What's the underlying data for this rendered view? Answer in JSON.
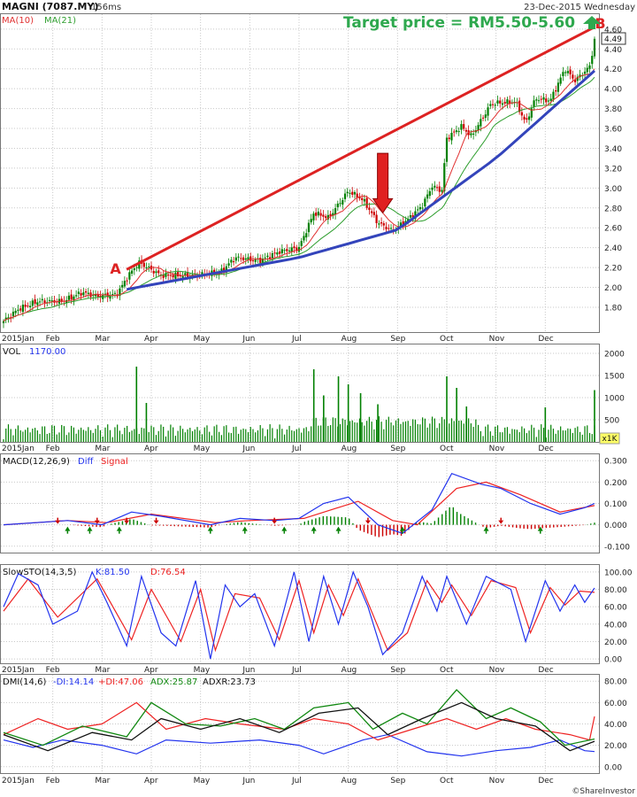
{
  "header": {
    "symbol": "MAGNI (7087.MY)",
    "render_time": "156ms",
    "date": "23-Dec-2015 Wednesday",
    "ma_fast_label": "MA(10)",
    "ma_slow_label": "MA(21)",
    "last_price": "4.49",
    "vol_scale": "x1K",
    "credit": "©ShareInvestor"
  },
  "annotations": {
    "target": "Target price =  RM5.50-5.60",
    "point_a": "A",
    "point_b": "B"
  },
  "colors": {
    "up": "#008000",
    "down": "#cc0000",
    "ma_fast": "#e03030",
    "ma_slow": "#2e9e2e",
    "resistance": "#dd2222",
    "support": "#3344bb",
    "target_text": "#2ea84e",
    "grid": "#c8c8c8",
    "macd_diff": "#2233ee",
    "macd_signal": "#ee2222",
    "sto_k": "#2233ee",
    "sto_d": "#ee2222",
    "dmi_minus": "#2233ee",
    "dmi_plus": "#ee2222",
    "adx": "#118811",
    "adxr": "#111111"
  },
  "chart_data": [
    {
      "type": "candlestick",
      "title": "MAGNI (7087.MY)",
      "x_ticks": [
        "2015Jan",
        "Feb",
        "Mar",
        "Apr",
        "May",
        "Jun",
        "Jul",
        "Aug",
        "Sep",
        "Oct",
        "Nov",
        "Dec"
      ],
      "y_ticks": [
        "1.80",
        "2.00",
        "2.20",
        "2.40",
        "2.60",
        "2.80",
        "3.00",
        "3.20",
        "3.40",
        "3.60",
        "3.80",
        "4.00",
        "4.20",
        "4.40",
        "4.60"
      ],
      "ylim": [
        1.55,
        4.75
      ],
      "close_anchors": [
        {
          "month": 0.0,
          "value": 1.66
        },
        {
          "month": 0.3,
          "value": 1.78
        },
        {
          "month": 0.7,
          "value": 1.86
        },
        {
          "month": 1.2,
          "value": 1.86
        },
        {
          "month": 1.6,
          "value": 1.95
        },
        {
          "month": 1.9,
          "value": 1.91
        },
        {
          "month": 2.3,
          "value": 1.93
        },
        {
          "month": 2.55,
          "value": 2.13
        },
        {
          "month": 2.75,
          "value": 2.25
        },
        {
          "month": 3.2,
          "value": 2.12
        },
        {
          "month": 3.8,
          "value": 2.12
        },
        {
          "month": 4.4,
          "value": 2.15
        },
        {
          "month": 4.7,
          "value": 2.3
        },
        {
          "month": 5.2,
          "value": 2.27
        },
        {
          "month": 5.6,
          "value": 2.36
        },
        {
          "month": 6.0,
          "value": 2.4
        },
        {
          "month": 6.3,
          "value": 2.75
        },
        {
          "month": 6.6,
          "value": 2.7
        },
        {
          "month": 7.0,
          "value": 2.97
        },
        {
          "month": 7.3,
          "value": 2.88
        },
        {
          "month": 7.6,
          "value": 2.65
        },
        {
          "month": 7.9,
          "value": 2.57
        },
        {
          "month": 8.2,
          "value": 2.68
        },
        {
          "month": 8.5,
          "value": 2.82
        },
        {
          "month": 8.7,
          "value": 3.02
        },
        {
          "month": 8.9,
          "value": 2.97
        },
        {
          "month": 9.0,
          "value": 3.5
        },
        {
          "month": 9.3,
          "value": 3.62
        },
        {
          "month": 9.5,
          "value": 3.52
        },
        {
          "month": 9.9,
          "value": 3.85
        },
        {
          "month": 10.4,
          "value": 3.87
        },
        {
          "month": 10.6,
          "value": 3.65
        },
        {
          "month": 10.8,
          "value": 3.9
        },
        {
          "month": 11.1,
          "value": 3.88
        },
        {
          "month": 11.4,
          "value": 4.2
        },
        {
          "month": 11.6,
          "value": 4.08
        },
        {
          "month": 11.9,
          "value": 4.22
        },
        {
          "month": 12.0,
          "value": 4.49
        }
      ],
      "resistance_line": [
        {
          "month": 2.5,
          "value": 2.18
        },
        {
          "month": 12.0,
          "value": 4.62
        }
      ],
      "support_points": [
        {
          "month": 2.5,
          "value": 1.98
        },
        {
          "month": 6.0,
          "value": 2.3
        },
        {
          "month": 8.0,
          "value": 2.58
        },
        {
          "month": 10.0,
          "value": 3.3
        },
        {
          "month": 12.0,
          "value": 4.18
        }
      ],
      "arrow": {
        "month": 7.7,
        "value_top": 3.35,
        "value_tip": 2.75
      },
      "point_a": {
        "month": 2.45,
        "value": 2.19
      },
      "point_b": {
        "month": 11.9,
        "value": 4.66
      }
    },
    {
      "type": "bar",
      "name": "VOL",
      "value_label": "1170.00",
      "y_ticks": [
        "500",
        "1000",
        "1500",
        "2000"
      ],
      "ylim": [
        0,
        2200
      ],
      "spikes": [
        {
          "month": 2.7,
          "value": 1700
        },
        {
          "month": 2.9,
          "value": 880
        },
        {
          "month": 6.3,
          "value": 1640
        },
        {
          "month": 6.5,
          "value": 1050
        },
        {
          "month": 6.8,
          "value": 1480
        },
        {
          "month": 7.0,
          "value": 1300
        },
        {
          "month": 7.25,
          "value": 1100
        },
        {
          "month": 7.6,
          "value": 850
        },
        {
          "month": 9.0,
          "value": 1480
        },
        {
          "month": 9.2,
          "value": 1220
        },
        {
          "month": 9.4,
          "value": 800
        },
        {
          "month": 11.0,
          "value": 780
        },
        {
          "month": 12.0,
          "value": 1170
        }
      ]
    },
    {
      "type": "line",
      "name": "MACD(12,26,9)",
      "series_labels": [
        "Diff",
        "Signal"
      ],
      "y_ticks": [
        "-0.100",
        "0.000",
        "0.100",
        "0.200",
        "0.300"
      ],
      "ylim": [
        -0.13,
        0.33
      ],
      "diff": [
        {
          "month": 0.0,
          "value": 0.0
        },
        {
          "month": 1.3,
          "value": 0.02
        },
        {
          "month": 2.0,
          "value": 0.0
        },
        {
          "month": 2.6,
          "value": 0.06
        },
        {
          "month": 3.2,
          "value": 0.04
        },
        {
          "month": 4.2,
          "value": 0.0
        },
        {
          "month": 4.8,
          "value": 0.03
        },
        {
          "month": 5.5,
          "value": 0.02
        },
        {
          "month": 6.0,
          "value": 0.03
        },
        {
          "month": 6.5,
          "value": 0.1
        },
        {
          "month": 7.0,
          "value": 0.13
        },
        {
          "month": 7.6,
          "value": 0.0
        },
        {
          "month": 8.1,
          "value": -0.04
        },
        {
          "month": 8.7,
          "value": 0.07
        },
        {
          "month": 9.1,
          "value": 0.24
        },
        {
          "month": 9.7,
          "value": 0.19
        },
        {
          "month": 10.1,
          "value": 0.17
        },
        {
          "month": 10.7,
          "value": 0.1
        },
        {
          "month": 11.3,
          "value": 0.05
        },
        {
          "month": 11.8,
          "value": 0.08
        },
        {
          "month": 12.0,
          "value": 0.1
        }
      ],
      "signal": [
        {
          "month": 0.0,
          "value": 0.0
        },
        {
          "month": 1.3,
          "value": 0.02
        },
        {
          "month": 2.1,
          "value": 0.01
        },
        {
          "month": 3.0,
          "value": 0.05
        },
        {
          "month": 4.3,
          "value": 0.01
        },
        {
          "month": 5.0,
          "value": 0.02
        },
        {
          "month": 6.1,
          "value": 0.03
        },
        {
          "month": 7.2,
          "value": 0.11
        },
        {
          "month": 7.9,
          "value": 0.02
        },
        {
          "month": 8.4,
          "value": 0.0
        },
        {
          "month": 9.2,
          "value": 0.17
        },
        {
          "month": 9.8,
          "value": 0.2
        },
        {
          "month": 10.5,
          "value": 0.14
        },
        {
          "month": 11.3,
          "value": 0.06
        },
        {
          "month": 12.0,
          "value": 0.09
        }
      ],
      "buy_signal_months": [
        1.3,
        1.75,
        2.35,
        4.2,
        4.9,
        5.7,
        6.3,
        6.8,
        8.1,
        9.8,
        10.9
      ],
      "sell_signal_months": [
        1.1,
        1.9,
        2.5,
        3.1,
        5.5,
        7.4,
        10.1
      ]
    },
    {
      "type": "line",
      "name": "SlowSTO(14,3,5)",
      "series_labels": [
        "K:81.50",
        "D:76.54"
      ],
      "y_ticks": [
        "0.00",
        "20.00",
        "40.00",
        "60.00",
        "80.00",
        "100.00"
      ],
      "ylim": [
        -5,
        108
      ],
      "k": [
        {
          "month": 0.0,
          "value": 60
        },
        {
          "month": 0.3,
          "value": 98
        },
        {
          "month": 0.7,
          "value": 85
        },
        {
          "month": 1.0,
          "value": 40
        },
        {
          "month": 1.5,
          "value": 55
        },
        {
          "month": 1.8,
          "value": 100
        },
        {
          "month": 2.1,
          "value": 65
        },
        {
          "month": 2.5,
          "value": 15
        },
        {
          "month": 2.8,
          "value": 95
        },
        {
          "month": 3.2,
          "value": 30
        },
        {
          "month": 3.5,
          "value": 15
        },
        {
          "month": 3.9,
          "value": 90
        },
        {
          "month": 4.2,
          "value": 0
        },
        {
          "month": 4.5,
          "value": 85
        },
        {
          "month": 4.8,
          "value": 60
        },
        {
          "month": 5.1,
          "value": 75
        },
        {
          "month": 5.5,
          "value": 15
        },
        {
          "month": 5.9,
          "value": 100
        },
        {
          "month": 6.2,
          "value": 20
        },
        {
          "month": 6.5,
          "value": 95
        },
        {
          "month": 6.8,
          "value": 40
        },
        {
          "month": 7.1,
          "value": 100
        },
        {
          "month": 7.4,
          "value": 60
        },
        {
          "month": 7.7,
          "value": 5
        },
        {
          "month": 8.1,
          "value": 30
        },
        {
          "month": 8.5,
          "value": 95
        },
        {
          "month": 8.8,
          "value": 55
        },
        {
          "month": 9.0,
          "value": 95
        },
        {
          "month": 9.4,
          "value": 40
        },
        {
          "month": 9.8,
          "value": 95
        },
        {
          "month": 10.3,
          "value": 80
        },
        {
          "month": 10.6,
          "value": 20
        },
        {
          "month": 11.0,
          "value": 90
        },
        {
          "month": 11.3,
          "value": 55
        },
        {
          "month": 11.6,
          "value": 85
        },
        {
          "month": 11.8,
          "value": 65
        },
        {
          "month": 12.0,
          "value": 81.5
        }
      ],
      "d": [
        {
          "month": 0.0,
          "value": 55
        },
        {
          "month": 0.5,
          "value": 92
        },
        {
          "month": 1.1,
          "value": 48
        },
        {
          "month": 1.9,
          "value": 92
        },
        {
          "month": 2.6,
          "value": 22
        },
        {
          "month": 3.0,
          "value": 80
        },
        {
          "month": 3.6,
          "value": 20
        },
        {
          "month": 4.0,
          "value": 80
        },
        {
          "month": 4.3,
          "value": 10
        },
        {
          "month": 4.7,
          "value": 75
        },
        {
          "month": 5.2,
          "value": 70
        },
        {
          "month": 5.6,
          "value": 22
        },
        {
          "month": 6.0,
          "value": 90
        },
        {
          "month": 6.3,
          "value": 30
        },
        {
          "month": 6.6,
          "value": 85
        },
        {
          "month": 6.9,
          "value": 50
        },
        {
          "month": 7.2,
          "value": 92
        },
        {
          "month": 7.8,
          "value": 10
        },
        {
          "month": 8.2,
          "value": 30
        },
        {
          "month": 8.6,
          "value": 90
        },
        {
          "month": 8.9,
          "value": 65
        },
        {
          "month": 9.1,
          "value": 85
        },
        {
          "month": 9.5,
          "value": 50
        },
        {
          "month": 9.9,
          "value": 90
        },
        {
          "month": 10.4,
          "value": 82
        },
        {
          "month": 10.7,
          "value": 30
        },
        {
          "month": 11.1,
          "value": 82
        },
        {
          "month": 11.4,
          "value": 62
        },
        {
          "month": 11.7,
          "value": 78
        },
        {
          "month": 12.0,
          "value": 76.5
        }
      ]
    },
    {
      "type": "line",
      "name": "DMI(14,6)",
      "series_labels": [
        "-DI:14.14",
        "+DI:47.06",
        "ADX:25.87",
        "ADXR:23.73"
      ],
      "y_ticks": [
        "0.00",
        "20.00",
        "40.00",
        "60.00",
        "80.00"
      ],
      "ylim": [
        -6,
        86
      ],
      "minus_di": [
        {
          "month": 0.0,
          "value": 25
        },
        {
          "month": 0.6,
          "value": 18
        },
        {
          "month": 1.2,
          "value": 25
        },
        {
          "month": 2.0,
          "value": 20
        },
        {
          "month": 2.7,
          "value": 12
        },
        {
          "month": 3.3,
          "value": 25
        },
        {
          "month": 4.2,
          "value": 22
        },
        {
          "month": 5.2,
          "value": 25
        },
        {
          "month": 6.0,
          "value": 20
        },
        {
          "month": 6.5,
          "value": 12
        },
        {
          "month": 7.3,
          "value": 25
        },
        {
          "month": 7.8,
          "value": 30
        },
        {
          "month": 8.6,
          "value": 14
        },
        {
          "month": 9.3,
          "value": 10
        },
        {
          "month": 10.0,
          "value": 15
        },
        {
          "month": 10.7,
          "value": 18
        },
        {
          "month": 11.3,
          "value": 25
        },
        {
          "month": 11.8,
          "value": 15
        },
        {
          "month": 12.0,
          "value": 14.14
        }
      ],
      "plus_di": [
        {
          "month": 0.0,
          "value": 30
        },
        {
          "month": 0.7,
          "value": 45
        },
        {
          "month": 1.3,
          "value": 35
        },
        {
          "month": 2.0,
          "value": 40
        },
        {
          "month": 2.7,
          "value": 60
        },
        {
          "month": 3.3,
          "value": 35
        },
        {
          "month": 4.1,
          "value": 45
        },
        {
          "month": 4.8,
          "value": 40
        },
        {
          "month": 5.7,
          "value": 35
        },
        {
          "month": 6.3,
          "value": 45
        },
        {
          "month": 7.0,
          "value": 40
        },
        {
          "month": 7.6,
          "value": 25
        },
        {
          "month": 8.3,
          "value": 35
        },
        {
          "month": 9.0,
          "value": 45
        },
        {
          "month": 9.6,
          "value": 35
        },
        {
          "month": 10.2,
          "value": 45
        },
        {
          "month": 10.8,
          "value": 35
        },
        {
          "month": 11.5,
          "value": 30
        },
        {
          "month": 11.9,
          "value": 25
        },
        {
          "month": 12.0,
          "value": 47.06
        }
      ],
      "adx": [
        {
          "month": 0.0,
          "value": 32
        },
        {
          "month": 0.8,
          "value": 20
        },
        {
          "month": 1.6,
          "value": 38
        },
        {
          "month": 2.5,
          "value": 28
        },
        {
          "month": 3.0,
          "value": 60
        },
        {
          "month": 3.7,
          "value": 40
        },
        {
          "month": 4.4,
          "value": 38
        },
        {
          "month": 5.1,
          "value": 45
        },
        {
          "month": 5.7,
          "value": 35
        },
        {
          "month": 6.3,
          "value": 55
        },
        {
          "month": 7.0,
          "value": 60
        },
        {
          "month": 7.5,
          "value": 35
        },
        {
          "month": 8.1,
          "value": 50
        },
        {
          "month": 8.6,
          "value": 40
        },
        {
          "month": 9.2,
          "value": 72
        },
        {
          "month": 9.8,
          "value": 45
        },
        {
          "month": 10.3,
          "value": 55
        },
        {
          "month": 10.9,
          "value": 42
        },
        {
          "month": 11.4,
          "value": 20
        },
        {
          "month": 12.0,
          "value": 25.87
        }
      ],
      "adxr": [
        {
          "month": 0.0,
          "value": 30
        },
        {
          "month": 0.9,
          "value": 15
        },
        {
          "month": 1.8,
          "value": 32
        },
        {
          "month": 2.6,
          "value": 25
        },
        {
          "month": 3.2,
          "value": 45
        },
        {
          "month": 4.0,
          "value": 35
        },
        {
          "month": 4.8,
          "value": 45
        },
        {
          "month": 5.6,
          "value": 32
        },
        {
          "month": 6.4,
          "value": 50
        },
        {
          "month": 7.2,
          "value": 55
        },
        {
          "month": 7.8,
          "value": 30
        },
        {
          "month": 8.5,
          "value": 45
        },
        {
          "month": 9.3,
          "value": 60
        },
        {
          "month": 10.0,
          "value": 45
        },
        {
          "month": 10.8,
          "value": 38
        },
        {
          "month": 11.5,
          "value": 15
        },
        {
          "month": 12.0,
          "value": 23.73
        }
      ]
    }
  ]
}
